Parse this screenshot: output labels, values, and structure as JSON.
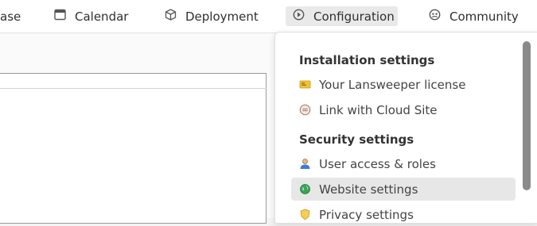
{
  "nav": {
    "items": [
      {
        "label": "ase",
        "icon": "database-icon"
      },
      {
        "label": "Calendar",
        "icon": "calendar-icon"
      },
      {
        "label": "Deployment",
        "icon": "package-icon"
      },
      {
        "label": "Configuration",
        "icon": "gear-circle-icon",
        "active": true
      },
      {
        "label": "Community",
        "icon": "people-icon"
      }
    ]
  },
  "dropdown": {
    "sections": [
      {
        "heading": "Installation settings",
        "items": [
          {
            "label": "Your Lansweeper license",
            "icon": "license-card-icon"
          },
          {
            "label": "Link with Cloud Site",
            "icon": "cloud-link-icon"
          }
        ]
      },
      {
        "heading": "Security settings",
        "items": [
          {
            "label": "User access & roles",
            "icon": "user-icon"
          },
          {
            "label": "Website settings",
            "icon": "globe-icon",
            "hovered": true
          },
          {
            "label": "Privacy settings",
            "icon": "shield-icon"
          }
        ]
      }
    ]
  },
  "colors": {
    "hover_bg": "#e7e7e7",
    "license_icon": "#f1c232",
    "user_icon": "#3d7bd9",
    "globe_icon": "#3aa54a"
  }
}
